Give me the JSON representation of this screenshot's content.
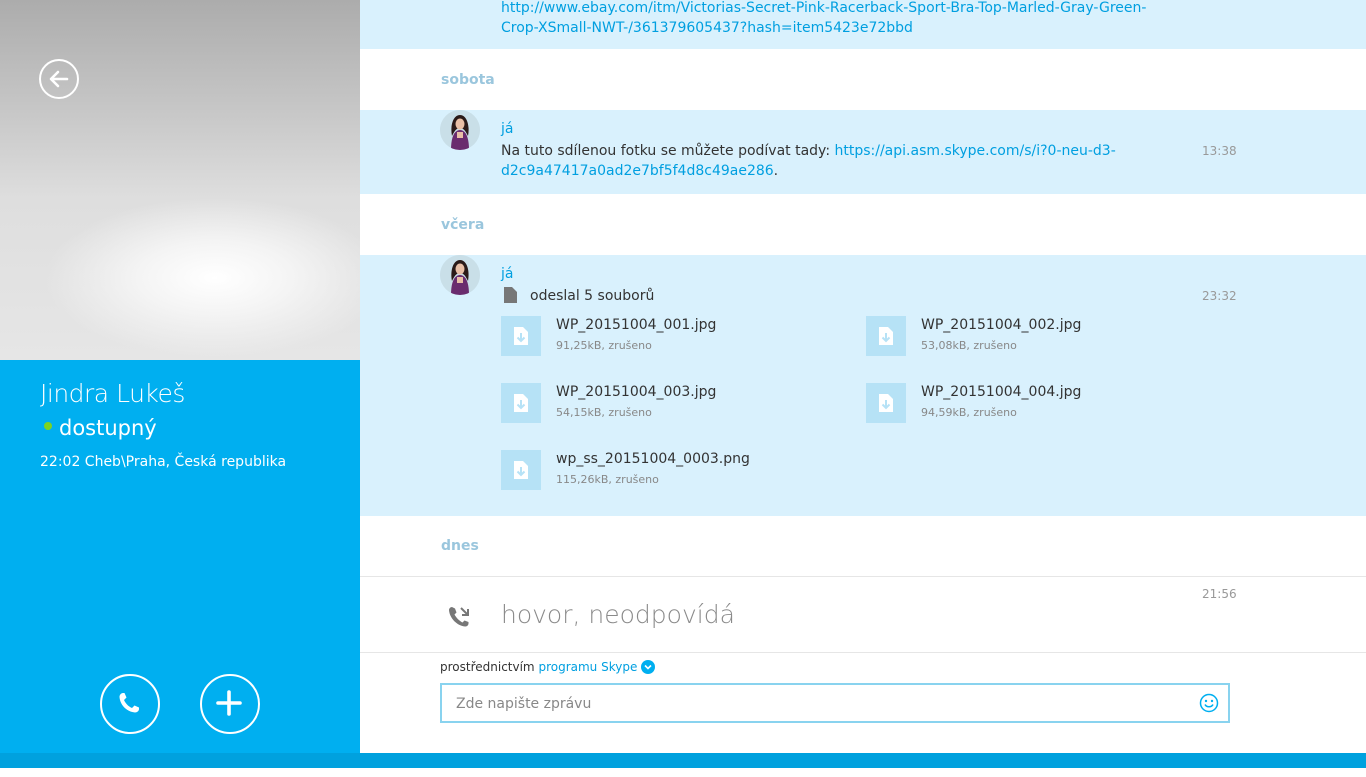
{
  "contact": {
    "name": "Jindra Lukeš",
    "status": "dostupný",
    "location": "22:02 Cheb\\Praha, Česká republika"
  },
  "colors": {
    "accent": "#00aff0",
    "message_band": "#d9f1fd",
    "status_online": "#7dd321",
    "link": "#009fe0",
    "day_label": "#9ac6dd"
  },
  "icons": {
    "back": "arrow-left-circle-icon",
    "call": "phone-icon",
    "add": "plus-icon",
    "file": "document-icon",
    "missed_call": "call-missed-icon",
    "emoji": "smiley-icon",
    "more": "ellipsis-icon"
  },
  "chat": {
    "top_link": {
      "line1": "http://www.ebay.com/itm/Victorias-Secret-Pink-Racerback-Sport-Bra-Top-Marled-Gray-Green-",
      "line2": "Crop-XSmall-NWT-/361379605437?hash=item5423e72bbd"
    },
    "days": {
      "saturday": "sobota",
      "yesterday": "včera",
      "today": "dnes"
    },
    "messages": [
      {
        "sender": "já",
        "text_prefix": "Na tuto sdílenou fotku se můžete podívat tady: ",
        "link_line1": "https://api.asm.skype.com/s/i?0-neu-d3-",
        "link_line2": "d2c9a47417a0ad2e7bf5f4d8c49ae286",
        "text_suffix": ".",
        "time": "13:38"
      },
      {
        "sender": "já",
        "summary": "odeslal 5 souborů",
        "time": "23:32",
        "files": [
          {
            "name": "WP_20151004_001.jpg",
            "meta": "91,25kB, zrušeno"
          },
          {
            "name": "WP_20151004_002.jpg",
            "meta": "53,08kB, zrušeno"
          },
          {
            "name": "WP_20151004_003.jpg",
            "meta": "54,15kB, zrušeno"
          },
          {
            "name": "WP_20151004_004.jpg",
            "meta": "94,59kB, zrušeno"
          },
          {
            "name": "wp_ss_20151004_0003.png",
            "meta": "115,26kB, zrušeno"
          }
        ]
      }
    ],
    "call_log": {
      "text": "hovor, neodpovídá",
      "time": "21:56"
    }
  },
  "composer": {
    "via_prefix": "prostřednictvím",
    "via_app": "programu Skype",
    "placeholder": "Zde napište zprávu"
  }
}
